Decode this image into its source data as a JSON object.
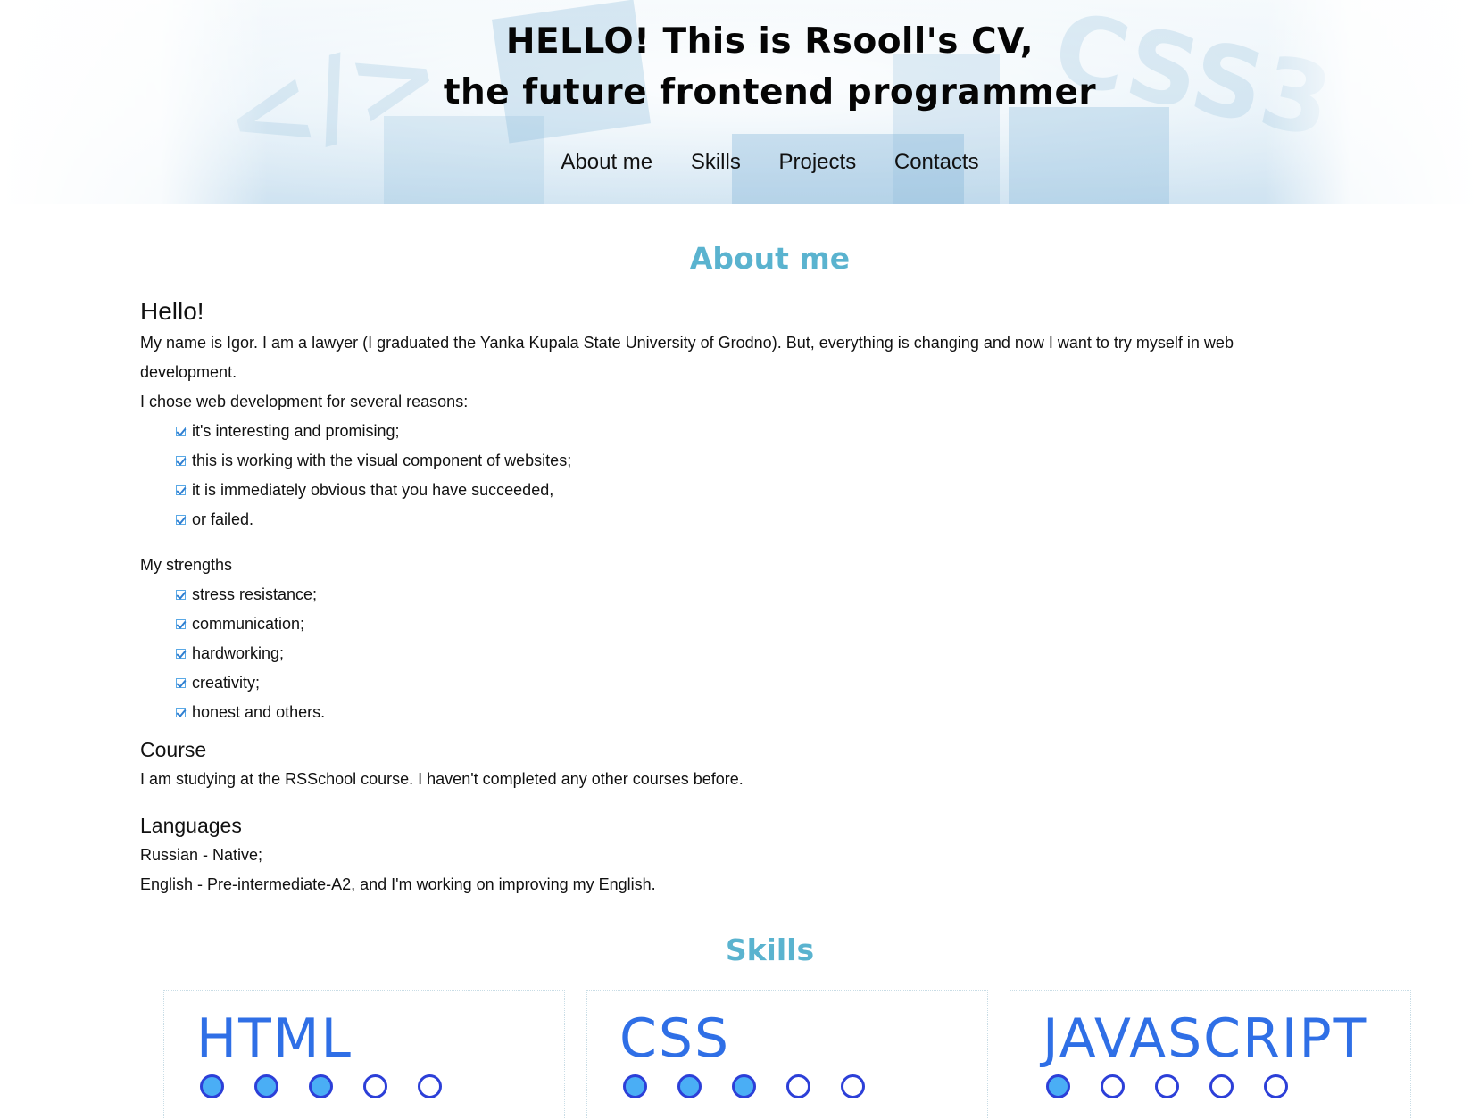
{
  "header": {
    "title_line1": "HELLO! This is Rsooll's CV,",
    "title_line2": "the future frontend programmer",
    "nav": [
      "About me",
      "Skills",
      "Projects",
      "Contacts"
    ]
  },
  "about": {
    "heading": "About me",
    "greeting": "Hello!",
    "intro": "My name is Igor. I am a lawyer (I graduated the Yanka Kupala State University of Grodno). But, everything is changing and now I want to try myself in web development.",
    "reasons_title": "I chose web development for several reasons:",
    "reasons": [
      "it's interesting and promising;",
      "this is working with the visual component of websites;",
      "it is immediately obvious that you have succeeded,",
      "or failed."
    ],
    "strengths_title": "My strengths",
    "strengths": [
      "stress resistance;",
      "communication;",
      "hardworking;",
      "creativity;",
      "honest and others."
    ],
    "course_title": "Course",
    "course_text": "I am studying at the RSSchool course. I haven't completed any other courses before.",
    "languages_title": "Languages",
    "languages": [
      "Russian - Native;",
      "English - Pre-intermediate-A2, and I'm working on improving my English."
    ]
  },
  "skills": {
    "heading": "Skills",
    "items": [
      {
        "name": "HTML",
        "level": 3,
        "max": 5
      },
      {
        "name": "CSS",
        "level": 3,
        "max": 5
      },
      {
        "name": "JAVASCRIPT",
        "level": 1,
        "max": 5
      }
    ]
  },
  "colors": {
    "section_heading": "#5ab3cf",
    "skill_text": "#2f6fe6",
    "dot_fill": "#4aaef5",
    "dot_border": "#2c3fd8"
  }
}
